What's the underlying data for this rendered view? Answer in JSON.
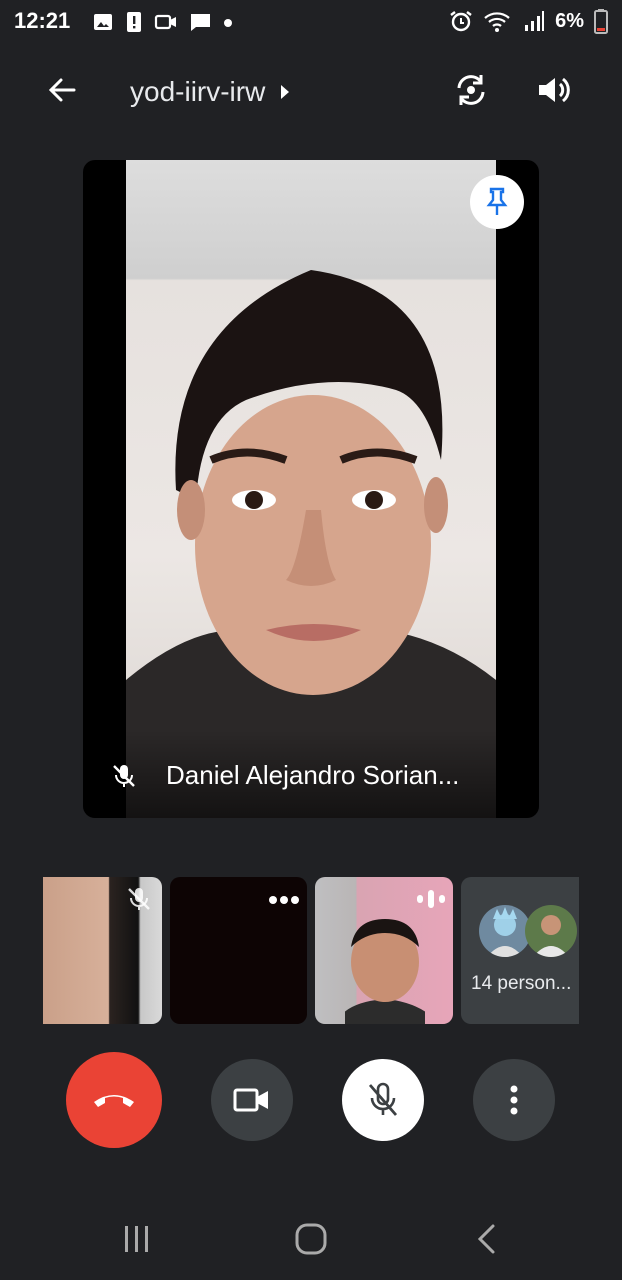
{
  "status_bar": {
    "time": "12:21",
    "battery": "6%",
    "icons": [
      "image-icon",
      "alert-icon",
      "video-icon",
      "message-icon",
      "dot-icon",
      "alarm-icon",
      "wifi-icon",
      "signal-icon",
      "battery-icon"
    ]
  },
  "top_bar": {
    "meeting_code": "yod-iirv-irw",
    "icons": [
      "back-arrow-icon",
      "chevron-right-icon",
      "switch-camera-icon",
      "speaker-icon"
    ]
  },
  "main_participant": {
    "name": "Daniel Alejandro Sorian...",
    "muted": true
  },
  "filmstrip": {
    "more_label": "14 person..."
  },
  "colors": {
    "background": "#202124",
    "end_call": "#ea4335",
    "tile_gray": "#3c4043",
    "pin_blue": "#1a73e8"
  }
}
